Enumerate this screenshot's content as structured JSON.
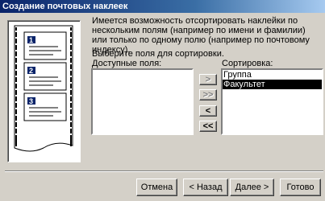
{
  "window": {
    "title": "Создание почтовых наклеек"
  },
  "content": {
    "description": "Имеется возможность отсортировать наклейки по нескольким полям (например по имени и фамилии) или только по одному полю (например по почтовому индексу).",
    "prompt": "Выберите поля для сортировки.",
    "available_label": "Доступные поля:",
    "sort_label": "Сортировка:",
    "available_items": [],
    "sort_items": [
      {
        "label": "Группа",
        "selected": false
      },
      {
        "label": "Факультет",
        "selected": true
      }
    ]
  },
  "move_buttons": {
    "add_one": ">",
    "add_all": ">>",
    "remove_one": "<",
    "remove_all": "<<"
  },
  "footer": {
    "cancel": "Отмена",
    "back": "< Назад",
    "next": "Далее >",
    "finish": "Готово"
  },
  "illustration": {
    "labels": [
      "1",
      "2",
      "3"
    ]
  },
  "colors": {
    "title_start": "#0a246a",
    "title_end": "#a6caf0",
    "face": "#d4d0c8",
    "selection": "#000000"
  }
}
